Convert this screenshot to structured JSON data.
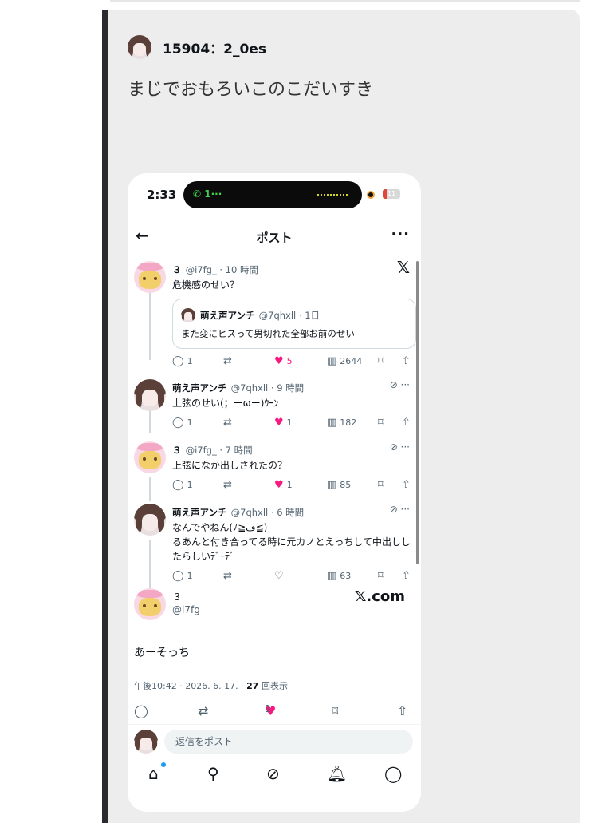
{
  "post": {
    "username": "15904：2_0es",
    "text": "まじでおもろいこのこだいすき"
  },
  "phone": {
    "status_time": "2:33",
    "call_label": "1···",
    "battery": "11",
    "nav_title": "ポスト",
    "back_icon": "arrow-left-icon",
    "more_icon": "more-horizontal-icon"
  },
  "thread": [
    {
      "name": "３",
      "handle": "@i7fg_ · 10 時間",
      "text": "危機感のせい？",
      "quote": {
        "name": "萌え声アンチ",
        "handle": "@7qhxll · 1日",
        "text": "また変にヒスって男切れた全部お前のせい"
      },
      "replies": "1",
      "likes": "5",
      "liked": true,
      "views": "2644"
    },
    {
      "name": "萌え声アンチ",
      "handle": "@7qhxll · 9 時間",
      "text": "上弦のせい(；ーωー)ｳｰﾝ",
      "replies": "1",
      "likes": "1",
      "liked": true,
      "views": "182"
    },
    {
      "name": "３",
      "handle": "@i7fg_ · 7 時間",
      "text": "上弦になか出しされたの？",
      "replies": "1",
      "likes": "1",
      "liked": true,
      "views": "85"
    },
    {
      "name": "萌え声アンチ",
      "handle": "@7qhxll · 6 時間",
      "text": "なんでやねん(ﾉ≧ڡ≦)\nるあんと付き合ってる時に元カノとえっちして中出ししたらしいﾃﾞｰﾃﾞ",
      "replies": "1",
      "likes": "",
      "liked": false,
      "views": "63"
    }
  ],
  "main_tweet": {
    "name": "３",
    "handle": "@i7fg_",
    "xcom": "𝕏.com",
    "text": "あーそっち",
    "meta_prefix": "午後10:42 · 2026. 6. 17. · ",
    "views_count": "27",
    "views_suffix": "回表示",
    "likes": "1"
  },
  "reply_placeholder": "返信をポスト",
  "colors": {
    "like": "#f91880",
    "muted": "#536471",
    "accent_dot": "#1d9bf0"
  }
}
